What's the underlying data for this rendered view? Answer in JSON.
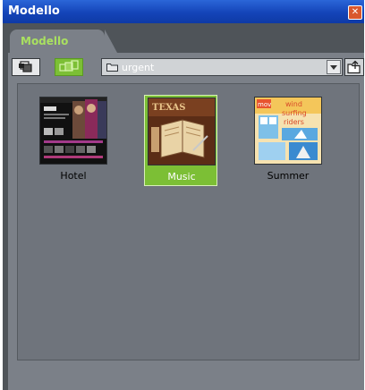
{
  "window": {
    "title": "Modello",
    "close_glyph": "✕"
  },
  "tab": {
    "label": "Modello"
  },
  "toolbar": {
    "buttons": [
      {
        "icon": "gallery-view-icon",
        "active": false
      },
      {
        "icon": "slideshow-view-icon",
        "active": true
      }
    ],
    "folder_select": {
      "icon": "folder-icon",
      "value": "urgent"
    },
    "up_button": {
      "icon": "folder-up-icon"
    }
  },
  "items": [
    {
      "label": "Hotel",
      "selected": false
    },
    {
      "label": "Music",
      "selected": true
    },
    {
      "label": "Summer",
      "selected": false
    }
  ],
  "thumbnail_text": {
    "music": "TEXAS",
    "summer": {
      "badge": "mov",
      "line1": "wind",
      "line2": "surfing",
      "line3": "riders"
    }
  },
  "colors": {
    "accent": "#7cbf35",
    "titlebar": "#1444b8",
    "panel": "#7b8088"
  }
}
